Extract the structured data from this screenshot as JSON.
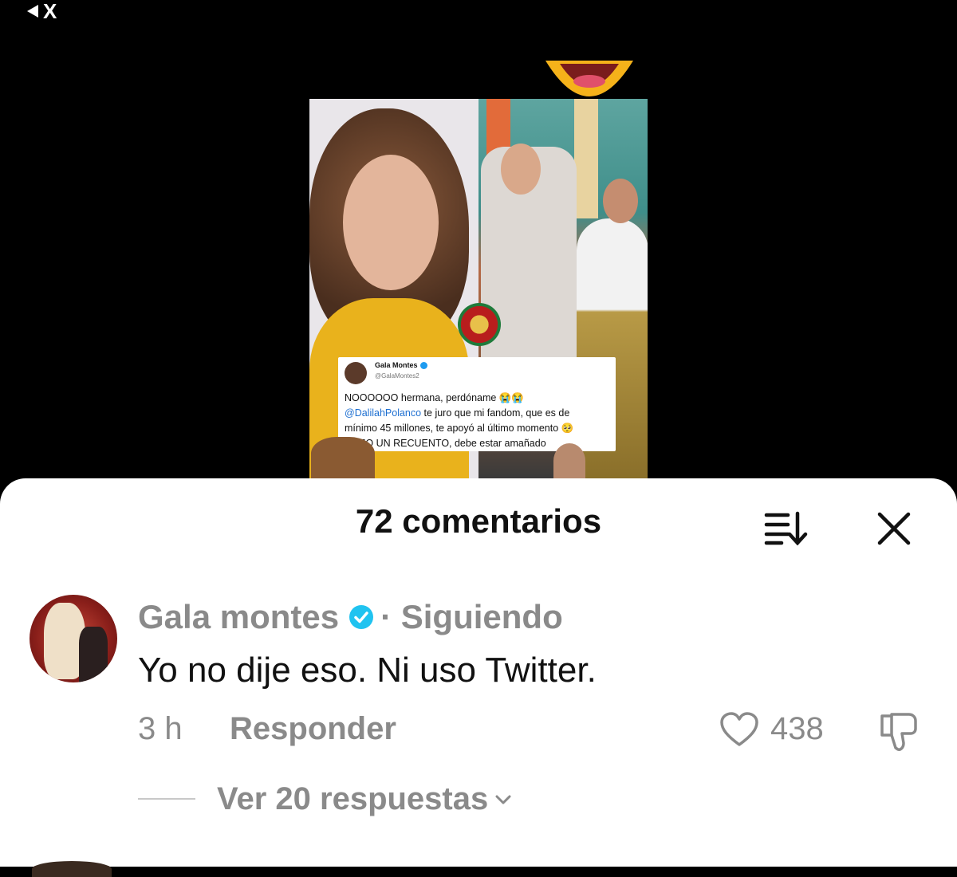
{
  "status": {
    "back_label": "X"
  },
  "video": {
    "tweet": {
      "name": "Gala Montes",
      "handle": "@GalaMontes2",
      "line1": "NOOOOOO hermana, perdóname 😭😭",
      "mention": "@DalilahPolanco",
      "line2_rest": " te juro que mi fandom, que es de",
      "line3": "mínimo 45 millones, te apoyó al último momento 🥺",
      "line4": "EXIJO UN RECUENTO, debe estar amañado"
    }
  },
  "sheet": {
    "title": "72 comentarios",
    "comment": {
      "author": "Gala montes",
      "following": "· Siguiendo",
      "text": "Yo no dije eso. Ni uso Twitter.",
      "time": "3 h",
      "reply_label": "Responder",
      "likes": "438",
      "view_replies": "Ver 20 respuestas"
    }
  },
  "icons": [
    "back-arrow-icon",
    "sort-icon",
    "close-icon",
    "verified-icon",
    "heart-icon",
    "dislike-icon",
    "chevron-down-icon"
  ],
  "colors": {
    "sheet_bg": "#ffffff",
    "muted": "#8a8a8a",
    "verified": "#20c3f0",
    "mention": "#1d6fd1"
  }
}
